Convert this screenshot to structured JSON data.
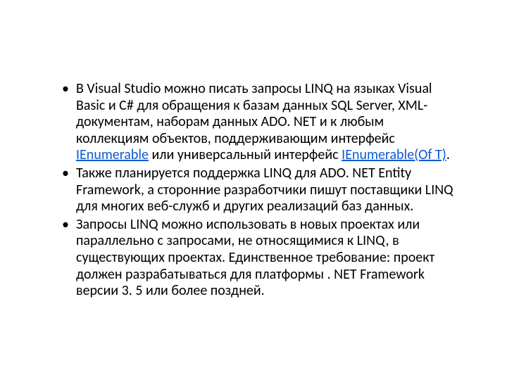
{
  "bullets": [
    {
      "pre": "В Visual Studio можно писать запросы LINQ на языках Visual Basic и C# для обращения к базам данных SQL Server, XML-документам, наборам данных ADO. NET и к любым коллекциям объектов, поддерживающим интерфейс ",
      "link1": "IEnumerable",
      "mid": " или универсальный интерфейс ",
      "link2": "IEnumerable(Of T)",
      "post": "."
    },
    {
      "text": "Также планируется поддержка LINQ для ADO. NET Entity Framework, а сторонние разработчики пишут поставщики LINQ для многих веб-служб и других реализаций баз данных."
    },
    {
      "text": "Запросы LINQ можно использовать в новых проектах или параллельно с запросами, не относящимися к LINQ, в существующих проектах. Единственное требование: проект должен разрабатываться для платформы . NET Framework версии 3. 5 или более поздней."
    }
  ]
}
